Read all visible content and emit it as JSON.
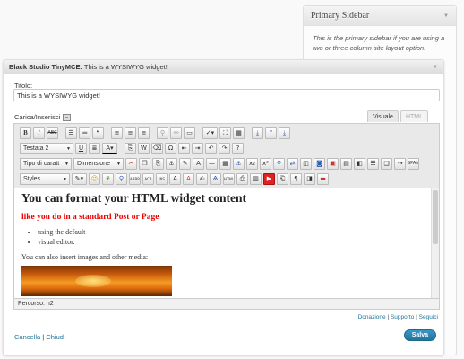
{
  "sidebar": {
    "title": "Primary Sidebar",
    "description": "This is the primary sidebar if you are using a two or three column site layout option."
  },
  "widget": {
    "title_bold": "Black Studio TinyMCE:",
    "title_rest": " This is a WYSIWYG widget!",
    "field_label": "Titolo:",
    "field_value": "This is a WYSIWYG widget!",
    "upload_label": "Carica/Inserisci",
    "tabs": {
      "visual": "Visuale",
      "html": "HTML"
    },
    "toolbar": {
      "format_select": "Testata 2",
      "font_select": "Tipo di caratt",
      "size_select": "Dimensione",
      "styles_select": "Styles"
    },
    "content": {
      "heading": "You can format your HTML widget content",
      "red_line": "like you do in a standard Post or Page",
      "list": [
        "using the default",
        "visual editor."
      ],
      "paragraph": "You can also insert images and other media:"
    },
    "path": "Percorso: h2",
    "links": {
      "donate": "Donazione",
      "support": "Supporto",
      "follow": "Seguici",
      "sep": " | "
    },
    "actions": {
      "cancel": "Cancella",
      "close": "Chiudi",
      "sep": " | ",
      "save": "Salva"
    }
  },
  "colors": {
    "accent": "#21759b",
    "red_text": "#ee0000"
  }
}
